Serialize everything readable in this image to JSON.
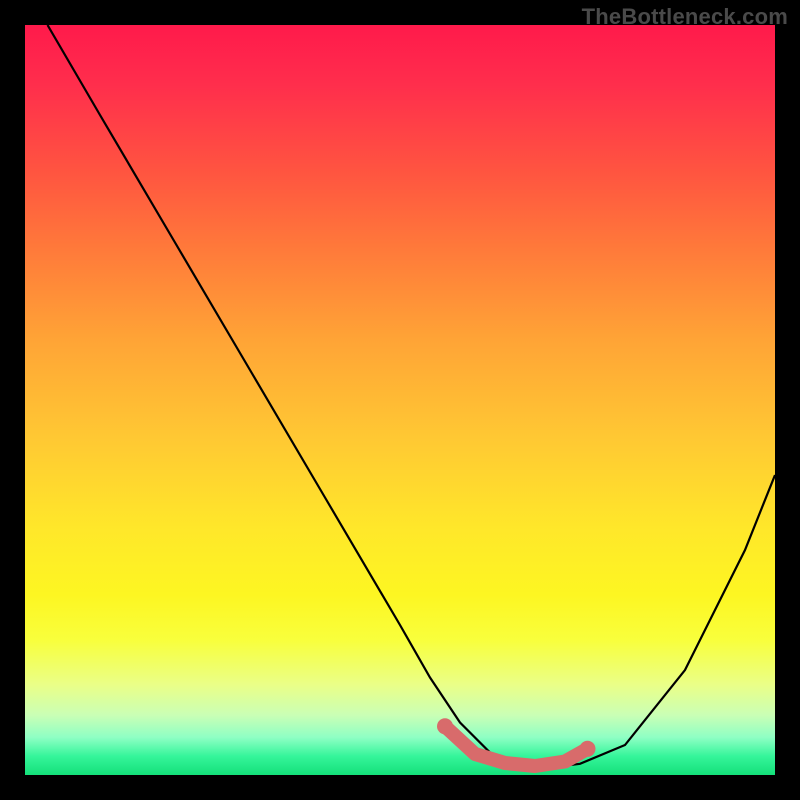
{
  "watermark": "TheBottleneck.com",
  "chart_data": {
    "type": "line",
    "title": "",
    "xlabel": "",
    "ylabel": "",
    "xlim": [
      0,
      100
    ],
    "ylim": [
      0,
      100
    ],
    "series": [
      {
        "name": "curve",
        "x": [
          3,
          10,
          20,
          30,
          40,
          50,
          54,
          58,
          62,
          66,
          70,
          74,
          80,
          88,
          96,
          100
        ],
        "y": [
          100,
          88,
          71,
          54,
          37,
          20,
          13,
          7,
          3,
          1.5,
          1,
          1.5,
          4,
          14,
          30,
          40
        ]
      }
    ],
    "highlight_segment": {
      "name": "flat-region",
      "x": [
        56,
        60,
        64,
        68,
        72,
        75
      ],
      "y": [
        6.5,
        2.8,
        1.6,
        1.2,
        1.8,
        3.5
      ]
    },
    "gradient_stops": [
      {
        "pos": 0,
        "color": "#ff1a4b"
      },
      {
        "pos": 0.3,
        "color": "#ff7a3a"
      },
      {
        "pos": 0.55,
        "color": "#ffc833"
      },
      {
        "pos": 0.76,
        "color": "#fdf622"
      },
      {
        "pos": 0.95,
        "color": "#8effc4"
      },
      {
        "pos": 1.0,
        "color": "#14e07a"
      }
    ]
  }
}
